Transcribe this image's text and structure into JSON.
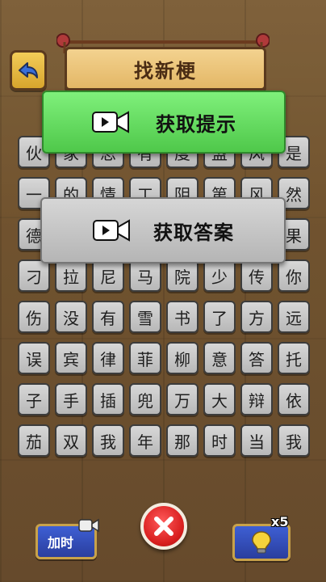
{
  "header": {
    "title": "找新梗",
    "back_icon": "back-arrow-icon"
  },
  "grid": {
    "rows": [
      [
        "伙",
        "家",
        "思",
        "有",
        "度",
        "盟",
        "风",
        "是"
      ],
      [
        "一",
        "的",
        "情",
        "工",
        "阴",
        "第",
        "风",
        "然"
      ],
      [
        "德",
        "",
        "",
        "",
        "",
        "",
        "",
        "果"
      ],
      [
        "刁",
        "拉",
        "尼",
        "马",
        "院",
        "少",
        "传",
        "你"
      ],
      [
        "伤",
        "没",
        "有",
        "雪",
        "书",
        "了",
        "方",
        "远"
      ],
      [
        "误",
        "宾",
        "律",
        "菲",
        "柳",
        "意",
        "答",
        "托"
      ],
      [
        "子",
        "手",
        "插",
        "兜",
        "万",
        "大",
        "辩",
        "依"
      ],
      [
        "茄",
        "双",
        "我",
        "年",
        "那",
        "时",
        "当",
        "我"
      ]
    ]
  },
  "popup": {
    "hint_label": "获取提示",
    "answer_label": "获取答案",
    "video_icon": "video-camera-icon"
  },
  "bottom": {
    "add_time_label": "加时",
    "close_icon": "close-x-icon",
    "bulb_icon": "lightbulb-icon",
    "bulb_count": "x5"
  },
  "colors": {
    "hint_green": "#5fd85a",
    "answer_gray": "#c6c6c6",
    "close_red": "#e02a2a",
    "bottom_blue": "#3450c0"
  }
}
